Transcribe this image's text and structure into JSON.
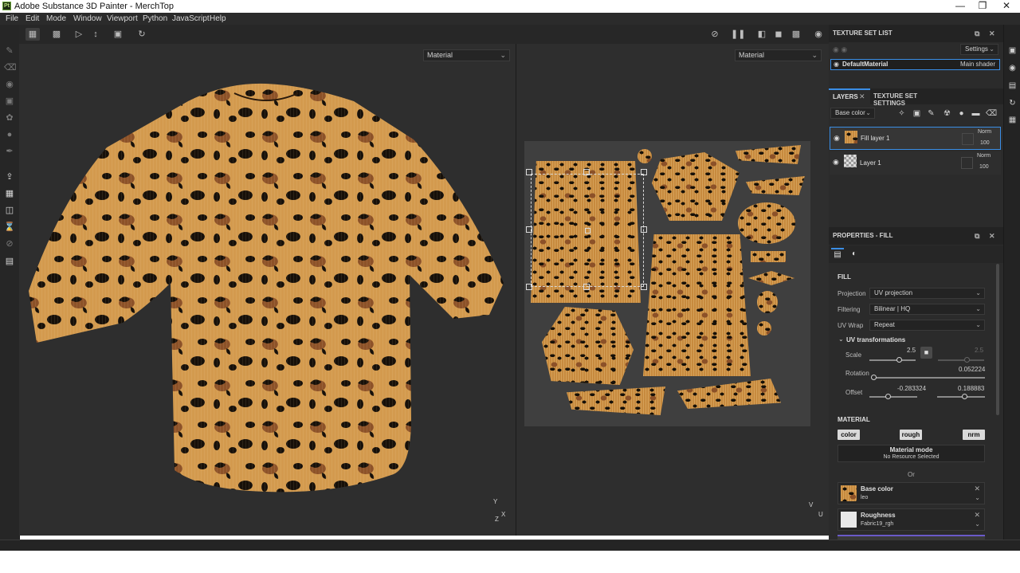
{
  "window": {
    "title": "Adobe Substance 3D Painter - MerchTop",
    "app_badge": "Pt"
  },
  "menu": [
    "File",
    "Edit",
    "Mode",
    "Window",
    "Viewport",
    "Python",
    "JavaScript",
    "Help"
  ],
  "viewport": {
    "left_select": "Material",
    "right_select": "Material",
    "axis_3d": {
      "y": "Y",
      "x": "X",
      "z": "Z"
    },
    "axis_2d": {
      "v": "V",
      "u": "U"
    }
  },
  "texture_set_list": {
    "title": "TEXTURE SET LIST",
    "settings_label": "Settings",
    "item_name": "DefaultMaterial",
    "item_shader": "Main shader"
  },
  "layers": {
    "tab_layers": "LAYERS",
    "tab_texture_set": "TEXTURE SET SETTINGS",
    "channel_select": "Base color",
    "items": [
      {
        "name": "Fill layer 1",
        "blend": "Norm",
        "opacity": "100"
      },
      {
        "name": "Layer 1",
        "blend": "Norm",
        "opacity": "100"
      }
    ]
  },
  "properties": {
    "title": "PROPERTIES - FILL",
    "fill_section": "FILL",
    "projection_label": "Projection",
    "projection_value": "UV projection",
    "filtering_label": "Filtering",
    "filtering_value": "Bilinear | HQ",
    "uvwrap_label": "UV Wrap",
    "uvwrap_value": "Repeat",
    "uv_transformations": "UV transformations",
    "scale_label": "Scale",
    "scale_value": "2.5",
    "scale_value_locked": "2.5",
    "rotation_label": "Rotation",
    "rotation_value": "0.052224",
    "offset_label": "Offset",
    "offset_x": "-0.283324",
    "offset_y": "0.188883",
    "material_section": "MATERIAL",
    "chip_color": "color",
    "chip_rough": "rough",
    "chip_nrm": "nrm",
    "material_mode_title": "Material mode",
    "material_mode_sub": "No Resource Selected",
    "or_label": "Or",
    "base_color_label": "Base color",
    "base_color_value": "leo",
    "roughness_label": "Roughness",
    "roughness_value": "Fabric19_rgh"
  },
  "colors": {
    "panel_bg": "#2b2b2b",
    "accent": "#3a8ee6",
    "leopard_base": "#c78a3e"
  }
}
